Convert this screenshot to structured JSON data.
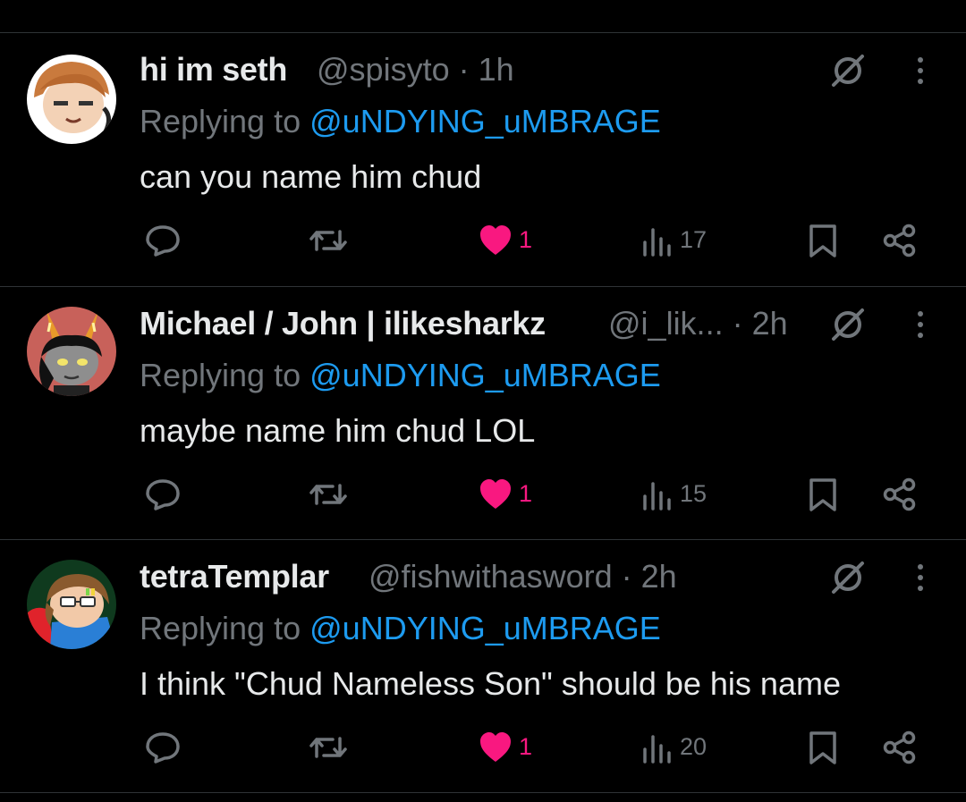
{
  "theme": {
    "background": "#000000",
    "text": "#e7e9ea",
    "muted": "#71767b",
    "link": "#1d9bf0",
    "like": "#f91880",
    "divider": "#2f3336"
  },
  "tweets": [
    {
      "display_name": "hi im seth",
      "handle": "@spisyto",
      "time": "· 1h",
      "replying_prefix": "Replying to",
      "replying_handle": "@uNDYING_uMBRAGE",
      "text": "can you name him chud",
      "likes": "1",
      "views": "17",
      "liked": true,
      "avatar_icon": "avatar-cartoon-face"
    },
    {
      "display_name": "Michael / John | ilikesharkz",
      "handle": "@i_lik...",
      "time": "· 2h",
      "replying_prefix": "Replying to",
      "replying_handle": "@uNDYING_uMBRAGE",
      "text": "maybe name him chud LOL",
      "likes": "1",
      "views": "15",
      "liked": true,
      "avatar_icon": "avatar-troll-horns"
    },
    {
      "display_name": "tetraTemplar",
      "handle": "@fishwithasword",
      "time": "· 2h",
      "replying_prefix": "Replying to",
      "replying_handle": "@uNDYING_uMBRAGE",
      "text": "I think \"Chud Nameless Son\" should be his name",
      "likes": "1",
      "views": "20",
      "liked": true,
      "avatar_icon": "avatar-glasses-character"
    }
  ]
}
